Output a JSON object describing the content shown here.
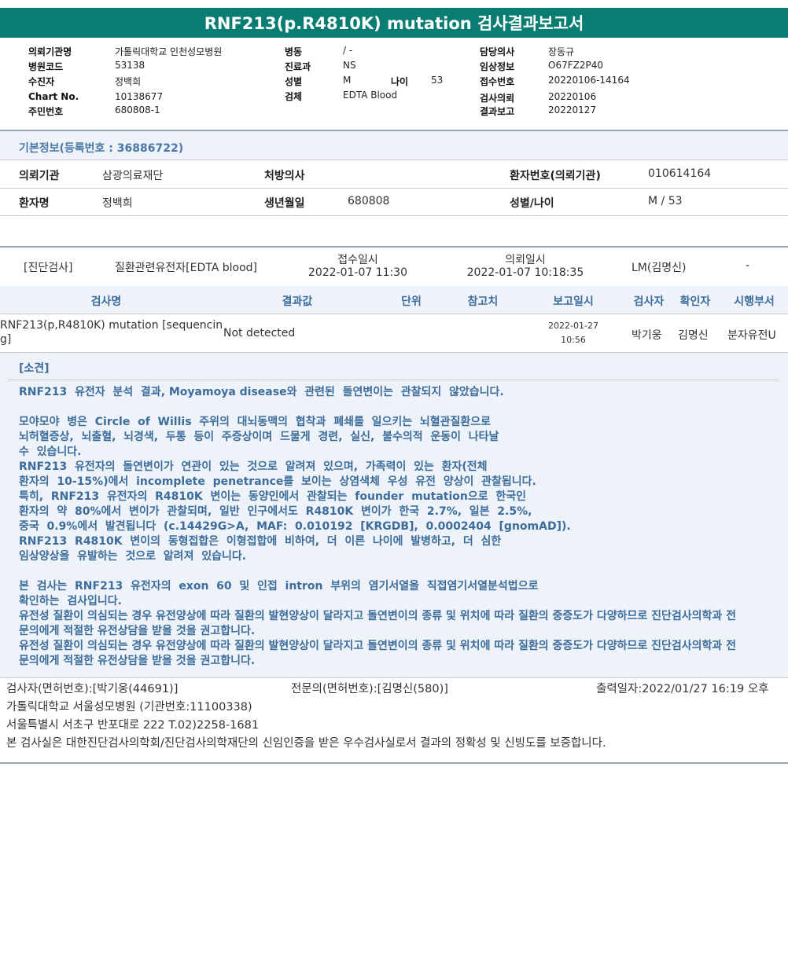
{
  "title": "RNF213(p.R4810K) mutation 검사결과보고서",
  "top_info": {
    "col1": [
      {
        "label": "의뢰기관명",
        "value": "가톨릭대학교 인천성모병원"
      },
      {
        "label": "병원코드",
        "value": "53138"
      },
      {
        "label": "수진자",
        "value": "정백희"
      },
      {
        "label": "Chart No.",
        "value": "10138677"
      },
      {
        "label": "주민번호",
        "value": "680808-1"
      }
    ],
    "col2": [
      {
        "label": "병동",
        "value": "/ -"
      },
      {
        "label": "진료과",
        "value": "NS"
      },
      {
        "label": "성별",
        "value": "M"
      },
      {
        "label": "검체",
        "value": "EDTA Blood"
      }
    ],
    "age_label": "나이",
    "age_value": "53",
    "col3": [
      {
        "label": "담당의사",
        "value": "장동규"
      },
      {
        "label": "임상정보",
        "value": "O67FZ2P40"
      },
      {
        "label": "접수번호",
        "value": "20220106-14164"
      },
      {
        "label": "검사의뢰",
        "value": "20220106"
      },
      {
        "label": "결과보고",
        "value": "20220127"
      }
    ]
  },
  "basic_info": {
    "title": "기본정보(등록번호 : 36886722)",
    "requester_label": "의뢰기관",
    "requester": "삼광의료재단",
    "doctor_label": "처방의사",
    "doctor": "",
    "patient_no_label": "환자번호(의뢰기관)",
    "patient_no": "010614164",
    "name_label": "환자명",
    "name": "정백희",
    "dob_label": "생년월일",
    "dob": "680808",
    "sexage_label": "성별/나이",
    "sexage": "M / 53"
  },
  "order": {
    "category": "[진단검사]",
    "test": "질환관련유전자[EDTA blood]",
    "receipt_label": "접수일시",
    "receipt": "2022-01-07  11:30",
    "request_label": "의뢰일시",
    "request": "2022-01-07  10:18:35",
    "lab": "LM(김명신)",
    "dash": "-"
  },
  "result_table": {
    "headers": [
      "검사명",
      "결과값",
      "단위",
      "참고치",
      "보고일시",
      "검사자",
      "확인자",
      "시행부서"
    ],
    "row": {
      "name_line1": "RNF213(p,R4810K) mutation [sequencin",
      "name_line2": "g]",
      "result": "Not detected",
      "unit": "",
      "reference": "",
      "report_date": "2022-01-27",
      "report_time": "10:56",
      "tester": "박기웅",
      "confirmer": "김명신",
      "dept": "분자유전U"
    }
  },
  "opinion": {
    "title": "[소견]",
    "text": "RNF213  유전자  분석  결과, Moyamoya disease와  관련된  돌연변이는  관찰되지  않았습니다.\n\n모야모야  병은  Circle  of  Willis  주위의  대뇌동맥의  협착과  폐쇄를  일으키는  뇌혈관질환으로\n뇌허혈증상,  뇌출혈,  뇌경색,  두통  등이  주증상이며  드물게  경련,  실신,  불수의적  운동이  나타날\n수  있습니다.\nRNF213  유전자의  돌연변이가  연관이  있는  것으로  알려져  있으며,  가족력이  있는  환자(전체\n환자의  10-15%)에서  incomplete  penetrance를  보이는  상염색체  우성  유전  양상이  관찰됩니다.\n특히,  RNF213  유전자의  R4810K  변이는  동양인에서  관찰되는  founder  mutation으로  한국인\n환자의  약  80%에서  변이가  관찰되며,  일반  인구에서도  R4810K  변이가  한국  2.7%,  일본  2.5%,\n중국  0.9%에서  발견됩니다  (c.14429G>A,  MAF:  0.010192  [KRGDB],  0.0002404  [gnomAD]).\nRNF213  R4810K  변이의  동형접합은  이형접합에  비하여,  더  이른  나이에  발병하고,  더  심한\n임상양상을  유발하는  것으로  알려져  있습니다.\n\n본  검사는  RNF213  유전자의  exon  60  및  인접  intron  부위의  염기서열을  직접염기서열분석법으로\n확인하는  검사입니다.\n유전성 질환이 의심되는 경우 유전양상에 따라 질환의 발현양상이 달라지고 돌연변이의 종류 및 위치에 따라 질환의 중증도가 다양하므로 진단검사의학과 전\n문의에게 적절한 유전상담을 받을 것을 권고합니다.\n유전성 질환이 의심되는 경우 유전양상에 따라 질환의 발현양상이 달라지고 돌연변이의 종류 및 위치에 따라 질환의 중증도가 다양하므로 진단검사의학과 전\n문의에게 적절한 유전상담을 받을 것을 권고합니다."
  },
  "footer": {
    "tester": "검사자(면허번호):[박기웅(44691)]",
    "specialist": "전문의(면허번호):[김명신(580)]",
    "printed": "출력일자:2022/01/27  16:19  오후",
    "hospital": "가톨릭대학교  서울성모병원  (기관번호:11100338)",
    "address": "서울특별시  서초구  반포대로  222  T.02)2258-1681",
    "certification": "본  검사실은  대한진단검사의학회/진단검사의학재단의  신임인증을  받은  우수검사실로서  결과의  정확성  및  신빙도를  보증합니다."
  },
  "colors": {
    "title_bg": "#0a7d73",
    "accent_text": "#3d6c9b",
    "band_bg": "#edf3f9"
  }
}
